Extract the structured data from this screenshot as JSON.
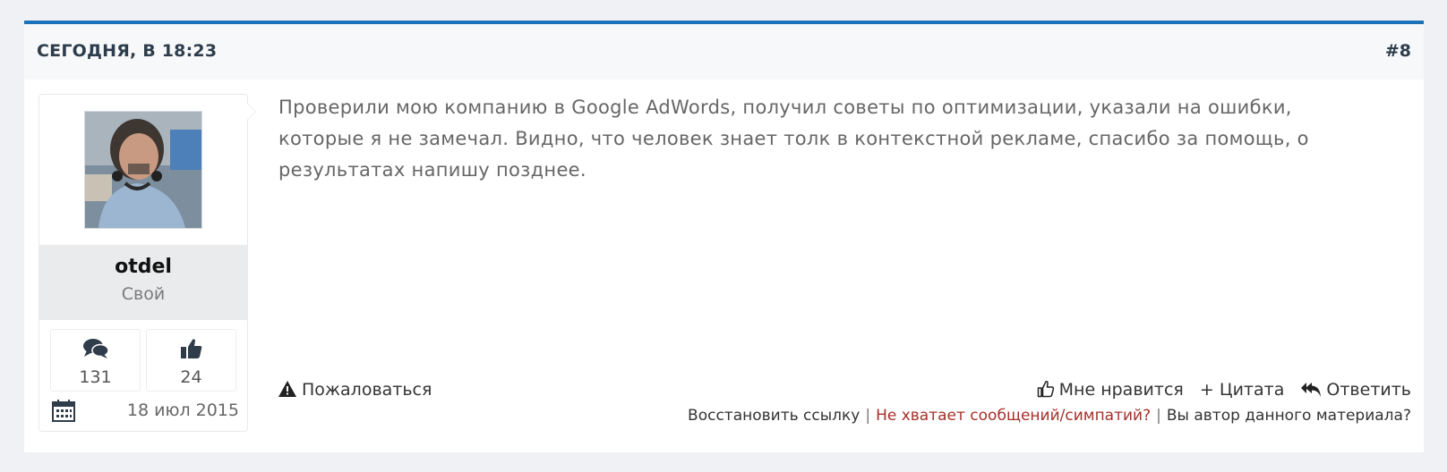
{
  "post": {
    "date": "СЕГОДНЯ, В 18:23",
    "number": "#8",
    "body": "Проверили мою компанию в Google AdWords, получил советы по оптимизации, указали на ошибки, которые я не замечал. Видно, что человек знает толк в контекстной рекламе, спасибо за помощь, о результатах напишу позднее."
  },
  "user": {
    "name": "otdel",
    "title": "Свой",
    "posts_count": "131",
    "likes_count": "24",
    "joined": "18 июл 2015"
  },
  "actions": {
    "report": "Пожаловаться",
    "like": "Мне нравится",
    "quote": "+ Цитата",
    "reply": "Ответить"
  },
  "links": {
    "restore": "Восстановить ссылку",
    "not_enough": "Не хватает сообщений/симпатий?",
    "author": "Вы автор данного материала?",
    "separator": "|"
  },
  "colors": {
    "accent": "#1b72b8",
    "warning_link": "#a5302a",
    "header_bg": "#f7f8fa"
  },
  "icons": [
    "comments-icon",
    "thumbs-up-icon",
    "calendar-icon",
    "warning-icon",
    "like-outline-icon",
    "reply-all-icon"
  ]
}
